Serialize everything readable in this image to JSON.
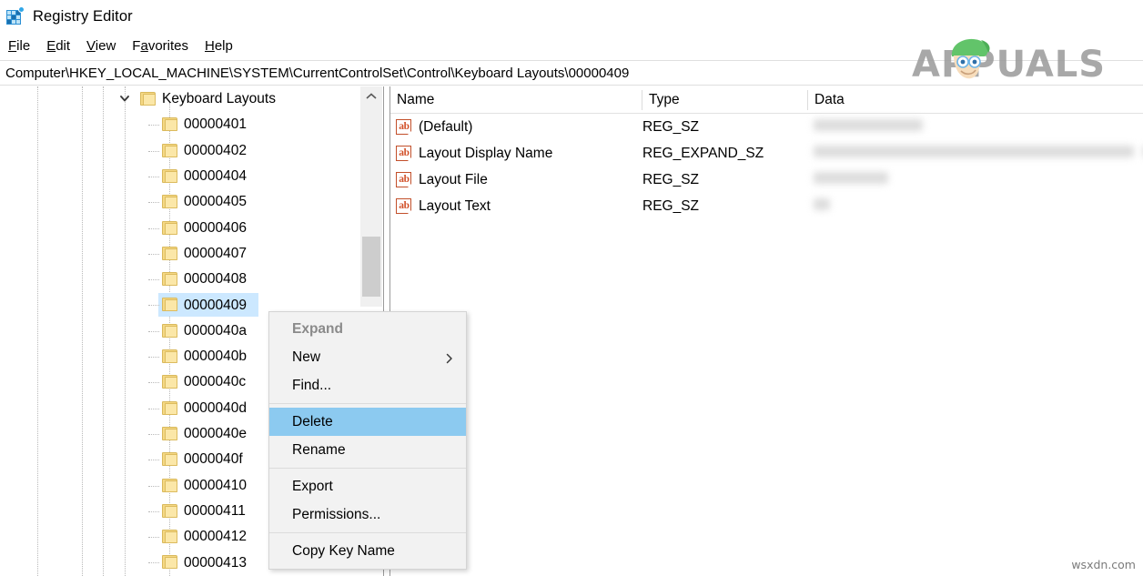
{
  "window": {
    "title": "Registry Editor",
    "icon": "registry-editor-icon"
  },
  "menubar": {
    "items": [
      {
        "label": "File",
        "accel": "F"
      },
      {
        "label": "Edit",
        "accel": "E"
      },
      {
        "label": "View",
        "accel": "V"
      },
      {
        "label": "Favorites",
        "accel": "a"
      },
      {
        "label": "Help",
        "accel": "H"
      }
    ]
  },
  "address": {
    "value": "Computer\\HKEY_LOCAL_MACHINE\\SYSTEM\\CurrentControlSet\\Control\\Keyboard Layouts\\00000409"
  },
  "tree": {
    "root": {
      "label": "Keyboard Layouts",
      "expanded": true
    },
    "items": [
      {
        "label": "00000401",
        "selected": false
      },
      {
        "label": "00000402",
        "selected": false
      },
      {
        "label": "00000404",
        "selected": false
      },
      {
        "label": "00000405",
        "selected": false
      },
      {
        "label": "00000406",
        "selected": false
      },
      {
        "label": "00000407",
        "selected": false
      },
      {
        "label": "00000408",
        "selected": false
      },
      {
        "label": "00000409",
        "selected": true
      },
      {
        "label": "0000040a",
        "selected": false
      },
      {
        "label": "0000040b",
        "selected": false
      },
      {
        "label": "0000040c",
        "selected": false
      },
      {
        "label": "0000040d",
        "selected": false
      },
      {
        "label": "0000040e",
        "selected": false
      },
      {
        "label": "0000040f",
        "selected": false
      },
      {
        "label": "00000410",
        "selected": false
      },
      {
        "label": "00000411",
        "selected": false
      },
      {
        "label": "00000412",
        "selected": false
      },
      {
        "label": "00000413",
        "selected": false
      }
    ]
  },
  "list": {
    "columns": [
      "Name",
      "Type",
      "Data"
    ],
    "rows": [
      {
        "name": "(Default)",
        "type": "REG_SZ",
        "data": ""
      },
      {
        "name": "Layout Display Name",
        "type": "REG_EXPAND_SZ",
        "data": ""
      },
      {
        "name": "Layout File",
        "type": "REG_SZ",
        "data": ""
      },
      {
        "name": "Layout Text",
        "type": "REG_SZ",
        "data": ""
      }
    ]
  },
  "context_menu": {
    "items": [
      {
        "label": "Expand",
        "state": "disabled"
      },
      {
        "label": "New",
        "state": "normal",
        "submenu": true
      },
      {
        "label": "Find...",
        "state": "normal"
      },
      {
        "separator": true
      },
      {
        "label": "Delete",
        "state": "selected"
      },
      {
        "label": "Rename",
        "state": "normal"
      },
      {
        "separator": true
      },
      {
        "label": "Export",
        "state": "normal"
      },
      {
        "label": "Permissions...",
        "state": "normal"
      },
      {
        "separator": true
      },
      {
        "label": "Copy Key Name",
        "state": "normal"
      }
    ]
  },
  "watermarks": {
    "brand": "APPUALS",
    "site": "wsxdn.com"
  },
  "colors": {
    "selection": "#cce8ff",
    "menu_selection": "#8ccaf0",
    "folder": "#f5d884",
    "accent": "#2a8fd4"
  }
}
